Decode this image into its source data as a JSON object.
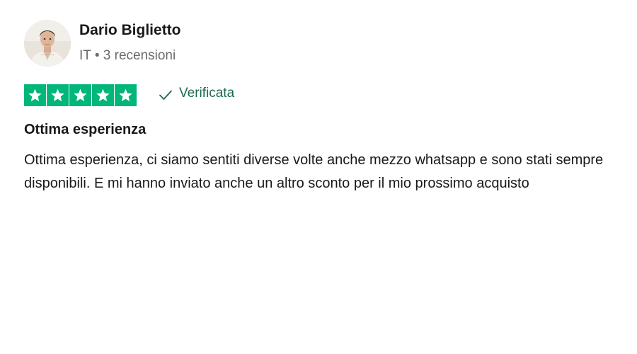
{
  "reviewer": {
    "name": "Dario Biglietto",
    "country": "IT",
    "separator": "•",
    "reviews_count": "3 recensioni",
    "avatar_icon": "user-avatar-photo"
  },
  "rating": {
    "stars": 5,
    "max_stars": 5,
    "color": "#00b67a"
  },
  "verified": {
    "label": "Verificata",
    "icon": "checkmark-icon",
    "color": "#1c6a4b"
  },
  "review": {
    "title": "Ottima esperienza",
    "body": "Ottima esperienza, ci siamo sentiti diverse volte anche mezzo whatsapp e sono stati sempre disponibili. E mi hanno inviato anche un altro sconto per il mio prossimo acquisto"
  }
}
